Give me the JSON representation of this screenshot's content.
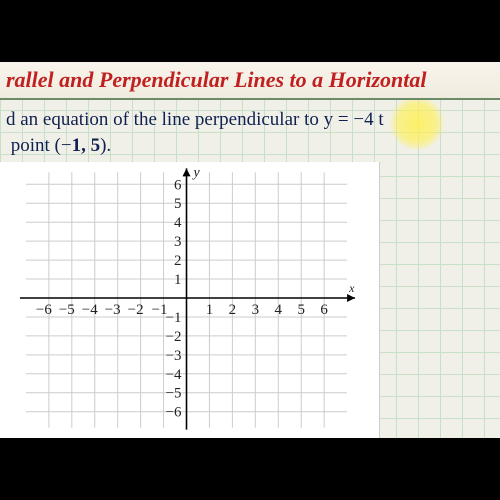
{
  "header": {
    "title": "rallel and Perpendicular Lines to a Horizontal"
  },
  "prompt": {
    "line1_a": "d an equation of the line perpendicular to y",
    "line1_b": "4 t",
    "line2_a": "point (",
    "neg1": "1",
    "comma_5": ", 5",
    "paren": ")."
  },
  "chart_data": {
    "type": "scatter",
    "title": "",
    "xlabel": "x",
    "ylabel": "y",
    "xlim": [
      -6,
      6
    ],
    "ylim": [
      -6,
      6
    ],
    "x_ticks": [
      -6,
      -5,
      -4,
      -3,
      -2,
      -1,
      1,
      2,
      3,
      4,
      5,
      6
    ],
    "y_ticks": [
      -6,
      -5,
      -4,
      -3,
      -2,
      -1,
      1,
      2,
      3,
      4,
      5,
      6
    ],
    "series": []
  }
}
